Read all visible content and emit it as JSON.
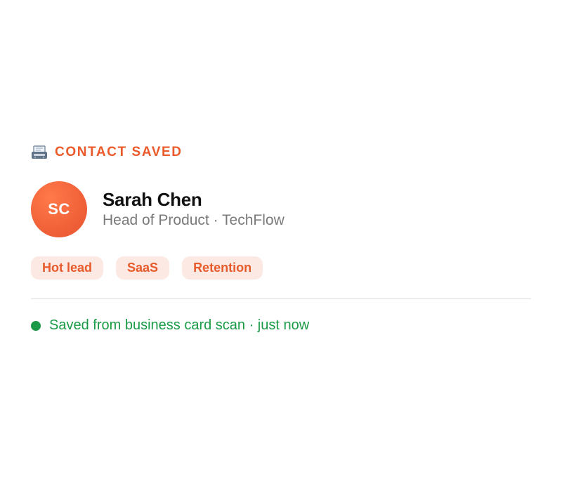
{
  "header": {
    "icon": "contact-card-icon",
    "title": "CONTACT SAVED",
    "accent_color": "#ea5a2a"
  },
  "contact": {
    "initials": "SC",
    "name": "Sarah Chen",
    "role": "Head of Product · TechFlow"
  },
  "tags": [
    {
      "label": "Hot lead"
    },
    {
      "label": "SaaS"
    },
    {
      "label": "Retention"
    }
  ],
  "status": {
    "text": "Saved from business card scan · just now",
    "color": "#1a9a46"
  }
}
